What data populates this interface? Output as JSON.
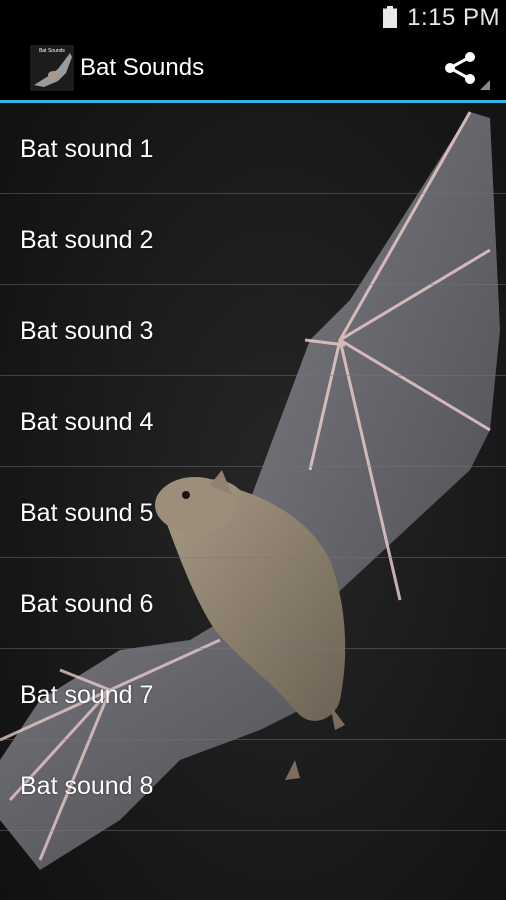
{
  "status_bar": {
    "time": "1:15 PM",
    "battery_icon": "battery-full-icon"
  },
  "action_bar": {
    "app_icon": "bat-app-icon",
    "app_icon_text": "Bat Sounds",
    "title": "Bat Sounds",
    "share_icon": "share-icon"
  },
  "colors": {
    "accent": "#33b5e5",
    "bar_background": "#000000",
    "text": "#ffffff"
  },
  "sounds": [
    {
      "label": "Bat sound 1"
    },
    {
      "label": "Bat sound 2"
    },
    {
      "label": "Bat sound 3"
    },
    {
      "label": "Bat sound 4"
    },
    {
      "label": "Bat sound 5"
    },
    {
      "label": "Bat sound 6"
    },
    {
      "label": "Bat sound 7"
    },
    {
      "label": "Bat sound 8"
    }
  ]
}
